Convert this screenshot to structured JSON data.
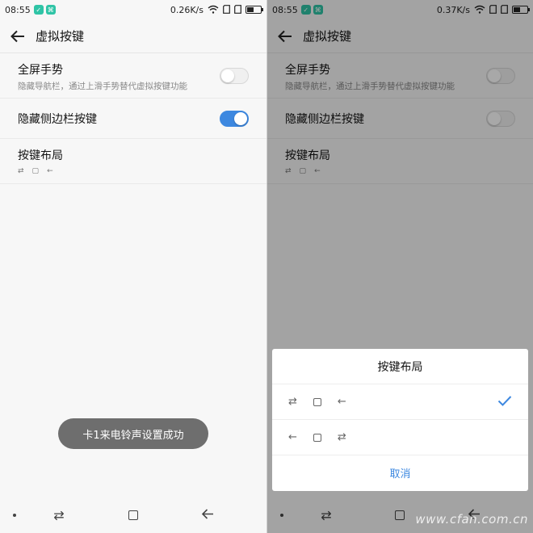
{
  "left": {
    "status": {
      "time": "08:55",
      "speed": "0.26K/s",
      "badges": [
        "app-badge-1",
        "app-badge-2"
      ]
    },
    "toolbar": {
      "title": "虚拟按键",
      "back_icon": "arrow-left-icon"
    },
    "settings": [
      {
        "title": "全屏手势",
        "desc": "隐藏导航栏，通过上滑手势替代虚拟按键功能",
        "toggle": false
      },
      {
        "title": "隐藏侧边栏按键",
        "toggle": true
      },
      {
        "title": "按键布局",
        "icons": [
          "⇄",
          "▢",
          "←"
        ]
      }
    ],
    "toast": "卡1来电铃声设置成功",
    "nav_icons": [
      "dot-icon",
      "switch-icon",
      "home-square-icon",
      "back-arrow-icon"
    ]
  },
  "right": {
    "status": {
      "time": "08:55",
      "speed": "0.37K/s"
    },
    "toolbar": {
      "title": "虚拟按键"
    },
    "settings": [
      {
        "title": "全屏手势",
        "desc": "隐藏导航栏，通过上滑手势替代虚拟按键功能",
        "toggle": false
      },
      {
        "title": "隐藏侧边栏按键",
        "toggle": false
      },
      {
        "title": "按键布局",
        "icons": [
          "⇄",
          "▢",
          "←"
        ]
      }
    ],
    "sheet": {
      "title": "按键布局",
      "options": [
        {
          "icons": [
            "⇄",
            "▢",
            "←"
          ],
          "selected": true
        },
        {
          "icons": [
            "←",
            "▢",
            "⇄"
          ],
          "selected": false
        }
      ],
      "cancel": "取消"
    }
  },
  "watermark": "www.cfan.com.cn",
  "colors": {
    "accent": "#3d88e0",
    "app_badge": "#2fc4a6",
    "toast_bg": "#6e6e6e"
  }
}
